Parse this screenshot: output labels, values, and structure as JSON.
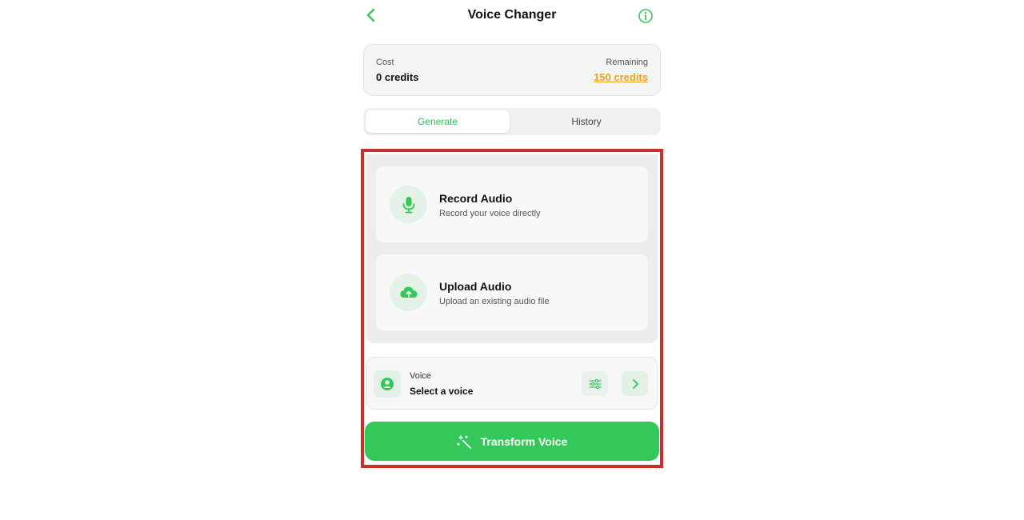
{
  "header": {
    "title": "Voice Changer",
    "back_icon": "chevron-left-icon",
    "info_icon": "info-icon"
  },
  "credits": {
    "cost_label": "Cost",
    "cost_value": "0 credits",
    "remaining_label": "Remaining",
    "remaining_value": "150 credits"
  },
  "tabs": [
    {
      "label": "Generate",
      "active": true
    },
    {
      "label": "History",
      "active": false
    }
  ],
  "options": [
    {
      "icon": "microphone-icon",
      "title": "Record Audio",
      "subtitle": "Record your voice directly"
    },
    {
      "icon": "cloud-upload-icon",
      "title": "Upload Audio",
      "subtitle": "Upload an existing audio file"
    }
  ],
  "voice": {
    "icon": "user-circle-icon",
    "label": "Voice",
    "value": "Select a voice",
    "settings_icon": "sliders-icon",
    "next_icon": "chevron-right-icon"
  },
  "action": {
    "icon": "magic-wand-icon",
    "label": "Transform Voice"
  },
  "colors": {
    "accent": "#34c759",
    "accent_text": "#33b95a",
    "remaining_highlight": "#e8a320",
    "frame": "#c8302d"
  }
}
